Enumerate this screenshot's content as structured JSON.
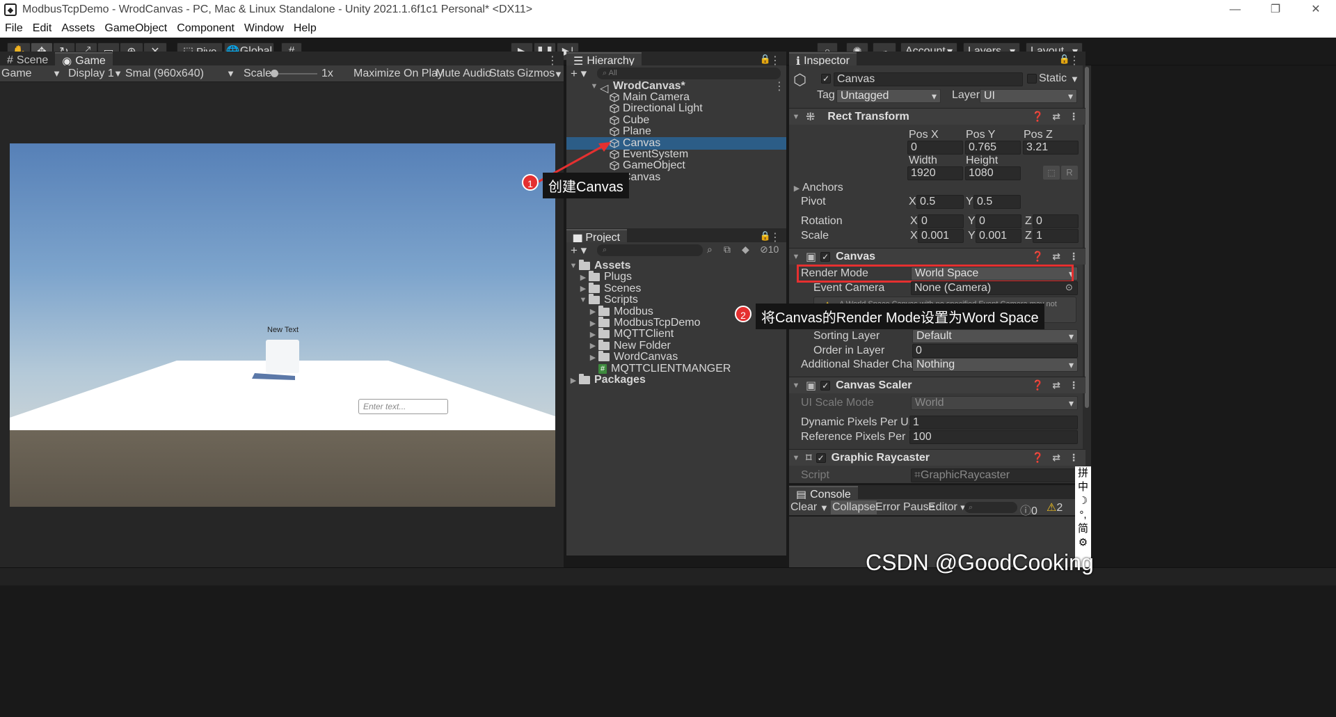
{
  "window": {
    "title": "ModbusTcpDemo - WrodCanvas - PC, Mac & Linux Standalone - Unity 2021.1.6f1c1 Personal* <DX11>"
  },
  "menu": [
    "File",
    "Edit",
    "Assets",
    "GameObject",
    "Component",
    "Window",
    "Help"
  ],
  "toolbar": {
    "pivot": "Pivo",
    "global": "Global",
    "account": "Account",
    "layers": "Layers",
    "layout": "Layout"
  },
  "game": {
    "tabs": [
      "Scene",
      "Game"
    ],
    "display_mode": "Game",
    "display": "Display 1",
    "resolution": "Smal (960x640)",
    "scale_label": "Scale",
    "scale_value": "1x",
    "buttons": [
      "Maximize On Play",
      "Mute Audio",
      "Stats",
      "Gizmos"
    ],
    "new_text": "New Text",
    "input_placeholder": "Enter text..."
  },
  "hierarchy": {
    "tab": "Hierarchy",
    "search_placeholder": "All",
    "root": "WrodCanvas*",
    "items": [
      "Main Camera",
      "Directional Light",
      "Cube",
      "Plane",
      "Canvas",
      "EventSystem",
      "GameObject",
      "Canvas"
    ]
  },
  "project": {
    "tab": "Project",
    "hidden_count": "10",
    "tree": [
      {
        "name": "Assets",
        "depth": 0,
        "open": true
      },
      {
        "name": "Plugs",
        "depth": 1
      },
      {
        "name": "Scenes",
        "depth": 1
      },
      {
        "name": "Scripts",
        "depth": 1,
        "open": true
      },
      {
        "name": "Modbus",
        "depth": 2
      },
      {
        "name": "ModbusTcpDemo",
        "depth": 2
      },
      {
        "name": "MQTTClient",
        "depth": 2
      },
      {
        "name": "New Folder",
        "depth": 2
      },
      {
        "name": "WordCanvas",
        "depth": 2
      },
      {
        "name": "MQTTCLIENTMANGER",
        "depth": 2,
        "script": true
      },
      {
        "name": "Packages",
        "depth": 0
      }
    ]
  },
  "inspector": {
    "tab": "Inspector",
    "object_name": "Canvas",
    "static": "Static",
    "tag_label": "Tag",
    "tag": "Untagged",
    "layer_label": "Layer",
    "layer": "UI",
    "rect": {
      "title": "Rect Transform",
      "posx_l": "Pos X",
      "posy_l": "Pos Y",
      "posz_l": "Pos Z",
      "posx": "0",
      "posy": "0.765",
      "posz": "3.21",
      "width_l": "Width",
      "height_l": "Height",
      "width": "1920",
      "height": "1080",
      "anchors": "Anchors",
      "pivot": "Pivot",
      "pivot_x": "0.5",
      "pivot_y": "0.5",
      "rotation": "Rotation",
      "rot_x": "0",
      "rot_y": "0",
      "rot_z": "0",
      "scale": "Scale",
      "sc_x": "0.001",
      "sc_y": "0.001",
      "sc_z": "1",
      "x": "X",
      "y": "Y",
      "z": "Z",
      "r_btn": "R"
    },
    "canvas": {
      "title": "Canvas",
      "render_mode_l": "Render Mode",
      "render_mode": "World Space",
      "event_camera_l": "Event Camera",
      "event_camera": "None (Camera)",
      "warning": "A World Space Canvas with no specified Event Camera may not",
      "sorting_layer_l": "Sorting Layer",
      "sorting_layer": "Default",
      "order_l": "Order in Layer",
      "order": "0",
      "shader_l": "Additional Shader Channe",
      "shader": "Nothing"
    },
    "scaler": {
      "title": "Canvas Scaler",
      "mode_l": "UI Scale Mode",
      "mode": "World",
      "dyn_l": "Dynamic Pixels Per Unit",
      "dyn": "1",
      "ref_l": "Reference Pixels Per Unit",
      "ref": "100"
    },
    "raycaster": {
      "title": "Graphic Raycaster",
      "script_l": "Script",
      "script": "GraphicRaycaster"
    }
  },
  "console": {
    "tab": "Console",
    "clear": "Clear",
    "collapse": "Collapse",
    "error_pause": "Error Pause",
    "editor": "Editor",
    "errors": "0",
    "warnings": "2"
  },
  "annotations": {
    "one": "1",
    "one_text": "创建Canvas",
    "two": "2",
    "two_text": "将Canvas的Render Mode设置为Word Space"
  },
  "ime": [
    "拼",
    "中",
    "简"
  ],
  "watermark": "CSDN @GoodCooking",
  "colors": {
    "selection": "#2c5d87",
    "highlight_box": "#e53030",
    "panel": "#383838"
  }
}
